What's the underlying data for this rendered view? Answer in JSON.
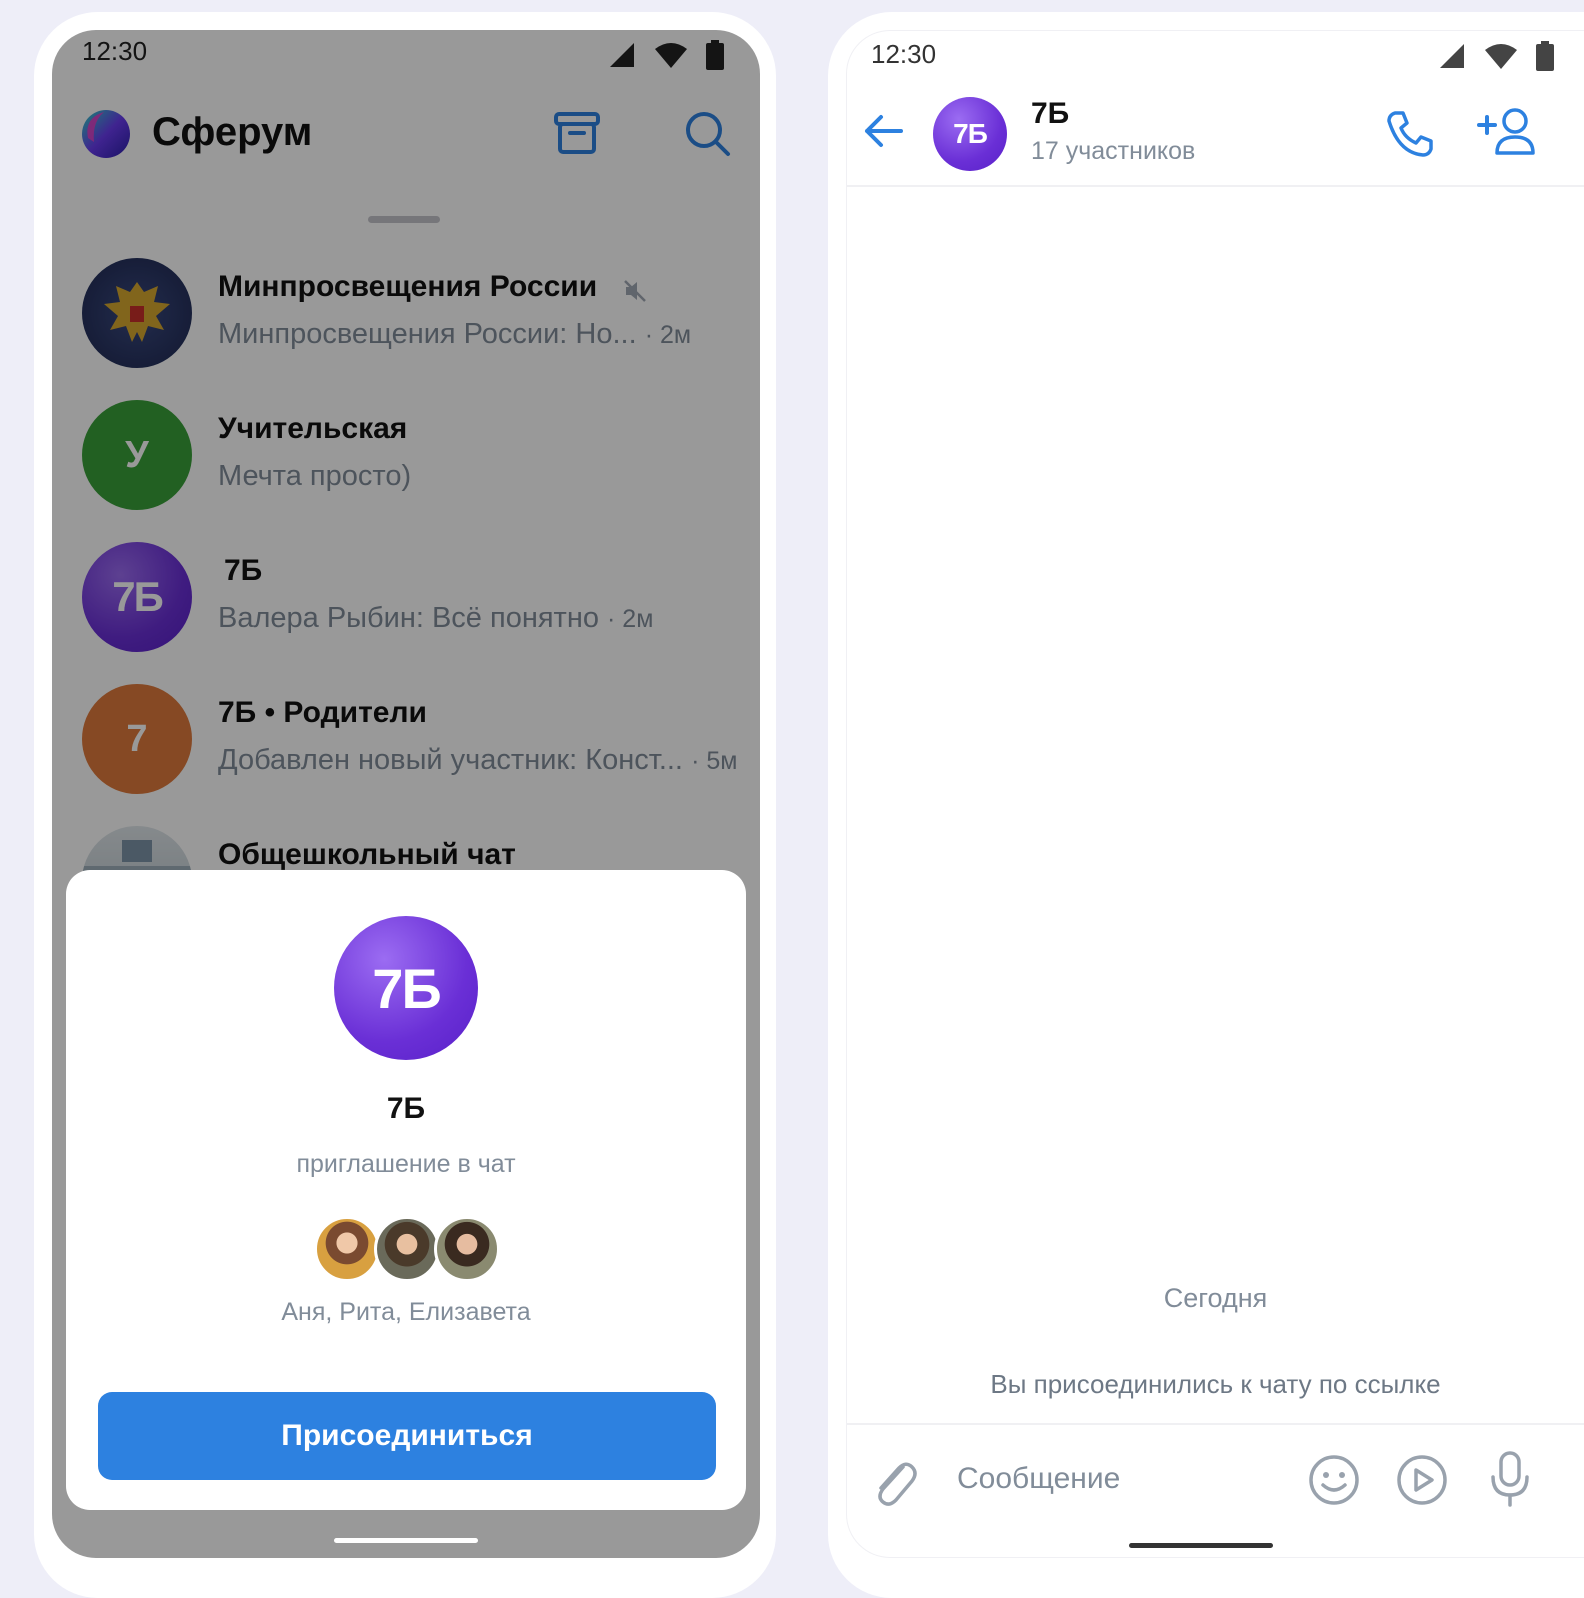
{
  "left_phone": {
    "status_time": "12:30",
    "app_title": "Сферум",
    "chats": [
      {
        "name": "Минпросвещения России",
        "preview": "Минпросвещения России: Но...",
        "time": "· 2м",
        "muted": true,
        "avatar_text": "",
        "avatar_color": "#2a3566"
      },
      {
        "name": "Учительская",
        "preview": "Мечта просто)",
        "time": "",
        "muted": false,
        "avatar_text": "У",
        "avatar_color": "#3aa03a"
      },
      {
        "name": "7Б",
        "preview": "Валера Рыбин: Всё понятно",
        "time": "· 2м",
        "muted": false,
        "avatar_text": "7Б",
        "avatar_color": "#6a2fd6"
      },
      {
        "name": "7Б • Родители",
        "preview": "Добавлен новый участник: Конст...",
        "time": "· 5м",
        "muted": false,
        "avatar_text": "7",
        "avatar_color": "#e07a3c"
      },
      {
        "name": "Общешкольный чат",
        "preview": "",
        "time": "",
        "muted": false,
        "avatar_text": "",
        "avatar_color": "#c8d2d8"
      }
    ],
    "invite_modal": {
      "avatar_text": "7Б",
      "title": "7Б",
      "subtitle": "приглашение в чат",
      "members": "Аня, Рита, Елизавета",
      "join_label": "Присоединиться"
    }
  },
  "right_phone": {
    "status_time": "12:30",
    "chat_avatar_text": "7Б",
    "chat_title": "7Б",
    "chat_subtitle": "17 участников",
    "date_separator": "Сегодня",
    "service_message": "Вы присоединились к чату по ссылке",
    "input_placeholder": "Сообщение"
  },
  "colors": {
    "accent": "#2d81e0",
    "icon_blue": "#2d81e0",
    "chat_purple": "#6a2fd6",
    "secondary_text": "#818c99"
  },
  "icons": [
    "signal-icon",
    "wifi-icon",
    "battery-icon",
    "sferum-logo",
    "archive-icon",
    "search-icon",
    "mute-icon",
    "back-arrow-icon",
    "phone-icon",
    "add-member-icon",
    "paperclip-icon",
    "emoji-icon",
    "video-message-icon",
    "microphone-icon"
  ]
}
